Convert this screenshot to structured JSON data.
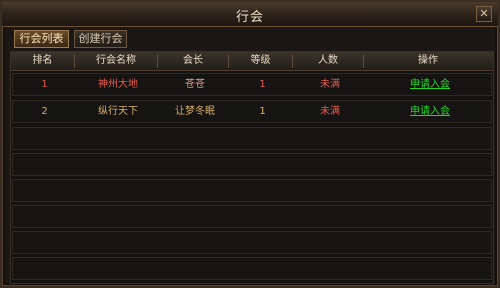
{
  "window": {
    "title": "行会",
    "close_label": "✕"
  },
  "tabs": [
    {
      "label": "行会列表",
      "active": true
    },
    {
      "label": "创建行会",
      "active": false
    }
  ],
  "table": {
    "columns": [
      "排名",
      "行会名称",
      "会长",
      "等级",
      "人数",
      "操作"
    ],
    "rows": [
      {
        "rank": "1",
        "name": "神州大地",
        "leader": "苍苍",
        "level": "1",
        "members": "未满",
        "action": "申请入会"
      },
      {
        "rank": "2",
        "name": "纵行天下",
        "leader": "让梦冬眠",
        "level": "1",
        "members": "未满",
        "action": "申请入会"
      }
    ]
  },
  "colors": {
    "accent": "#27d32b",
    "header_bg": "#3b342d",
    "row_border": "#2f2923"
  }
}
